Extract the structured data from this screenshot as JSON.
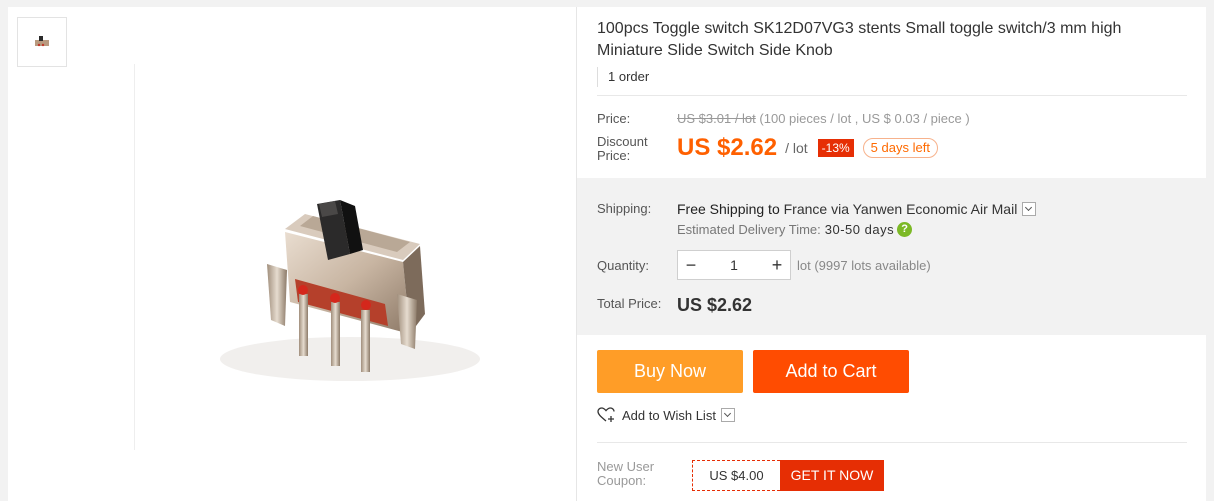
{
  "product": {
    "title": "100pcs Toggle switch SK12D07VG3 stents Small toggle switch/3 mm high Miniature Slide Switch Side Knob",
    "orders": "1 order"
  },
  "price": {
    "label": "Price:",
    "original": "US $3.01 / lot",
    "detail": "(100 pieces / lot , US $ 0.03 / piece )",
    "discount_label_1": "Discount",
    "discount_label_2": "Price:",
    "discount_value": "US $2.62",
    "discount_unit": "/ lot",
    "discount_badge": "-13%",
    "days_left": "5 days left"
  },
  "shipping": {
    "label": "Shipping:",
    "free": "Free Shipping to",
    "destination": "France via Yanwen Economic Air Mail",
    "estimate_label": "Estimated Delivery Time:",
    "estimate_value": "30-50 days"
  },
  "quantity": {
    "label": "Quantity:",
    "minus": "−",
    "value": "1",
    "plus": "+",
    "note": "lot (9997 lots available)"
  },
  "total": {
    "label": "Total Price:",
    "value": "US $2.62"
  },
  "actions": {
    "buy_now": "Buy Now",
    "add_to_cart": "Add to Cart",
    "wish_list": "Add to Wish List"
  },
  "coupon": {
    "label_1": "New User",
    "label_2": "Coupon:",
    "amount": "US $4.00",
    "get": "GET IT NOW"
  },
  "colors": {
    "accent_orange": "#ff6000",
    "buy_now": "#ff9d27",
    "add_to_cart": "#ff4c01",
    "badge_red": "#e62e04",
    "help_green": "#7cb926"
  }
}
